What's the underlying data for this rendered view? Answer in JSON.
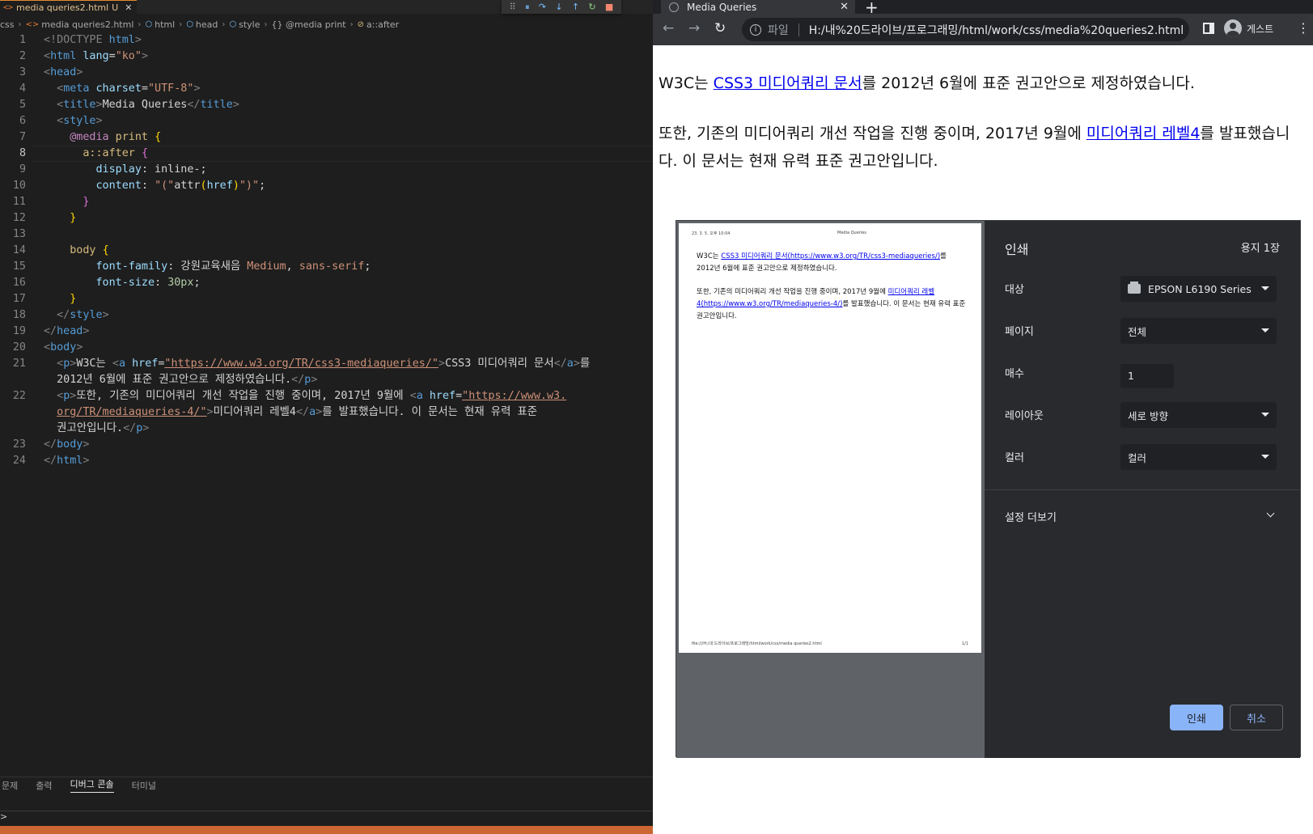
{
  "editor": {
    "tab": {
      "file_icon": "<>",
      "label": "media queries2.html",
      "status": "U",
      "close": "✕"
    },
    "debug_toolbar": [
      "⠿",
      "⏸",
      "↷",
      "↓",
      "↑",
      "↻",
      "■"
    ],
    "breadcrumb": [
      "css",
      "media queries2.html",
      "html",
      "head",
      "style",
      "{} @media print",
      "a::after"
    ],
    "lines": [
      "1",
      "2",
      "3",
      "4",
      "5",
      "6",
      "7",
      "8",
      "9",
      "10",
      "11",
      "12",
      "13",
      "14",
      "15",
      "16",
      "17",
      "18",
      "19",
      "20",
      "21",
      "",
      "22",
      "",
      "",
      "23",
      "24"
    ],
    "code": {
      "l1_doctype": "<!DOCTYPE ",
      "l1_html": "html",
      "l1_end": ">",
      "l2_open": "<",
      "l2_tag": "html",
      "l2_attr": " lang",
      "l2_eq": "=",
      "l2_val": "\"ko\"",
      "l2_end": ">",
      "l3": "head",
      "l4_tag": "meta",
      "l4_attr": " charset",
      "l4_val": "\"UTF-8\"",
      "l5_tag": "title",
      "l5_text": "Media Queries",
      "l6": "style",
      "l7_at": "@media",
      "l7_word": " print ",
      "l8_sel": "a::after",
      "l9_prop": "display",
      "l9_val": " inline-;",
      "l10_prop": "content",
      "l10_val1": "\"(\"",
      "l10_fn": "attr",
      "l10_arg": "href",
      "l10_val2": "\")\"",
      "l14_sel": "body",
      "l15_prop": "font-family",
      "l15_val1": " 강원교육새음 ",
      "l15_val2": "Medium",
      "l15_val3": "sans-serif",
      "l16_prop": "font-size",
      "l16_val": "30px",
      "l17": "}",
      "l18": "style",
      "l19": "head",
      "l20": "body",
      "l21_p": "p",
      "l21_text1": "W3C는 ",
      "l21_a": "a",
      "l21_href": " href",
      "l21_url": "\"https://www.w3.org/TR/css3-mediaqueries/\"",
      "l21_text2": "CSS3 미디어쿼리 문서",
      "l21_text3": "를",
      "l21b_text": "2012년 6월에 표준 권고안으로 제정하였습니다.",
      "l22_text1": "또한, 기존의 미디어쿼리 개선 작업을 진행 중이며, 2017년 9월에 ",
      "l22_url1": "\"https://www.w3.",
      "l22b_url2": "org/TR/mediaqueries-4/\"",
      "l22b_text1": "미디어쿼리 레벨4",
      "l22b_text2": "를 발표했습니다. 이 문서는 현재 유력 표준",
      "l22c_text": "권고안입니다.",
      "l23": "body",
      "l24": "html"
    },
    "panel_tabs": [
      "문제",
      "출력",
      "디버그 콘솔",
      "터미널"
    ],
    "panel_prompt": ">"
  },
  "browser": {
    "tab_title": "Media Queries",
    "tab_close": "✕",
    "new_tab": "+",
    "nav": {
      "back": "←",
      "forward": "→",
      "reload": "↻"
    },
    "omnibox": {
      "scheme": "파일",
      "url": "H:/내%20드라이브/프로그래밍/html/work/css/media%20queries2.html"
    },
    "profile": "게스트",
    "menu": "⋮",
    "page": {
      "p1_before": "W3C는 ",
      "p1_link": "CSS3 미디어쿼리 문서",
      "p1_after": "를 2012년 6월에 표준 권고안으로 제정하였습니다.",
      "p2_before": "또한, 기존의 미디어쿼리 개선 작업을 진행 중이며, 2017년 9월에 ",
      "p2_link": "미디어쿼리 레벨4",
      "p2_after": "를 발표했습니다. 이 문서는 현재 유력 표준 권고안입니다."
    }
  },
  "print_dialog": {
    "preview": {
      "header_date": "23. 3. 5. 오후 10:04",
      "header_title": "Media Queries",
      "p1_before": "W3C는 ",
      "p1_link": "CSS3 미디어쿼리 문서(https://www.w3.org/TR/css3-mediaqueries/)",
      "p1_after": "를 2012년 6월에 표준 권고안으로 제정하였습니다.",
      "p2_before": "또한, 기존의 미디어쿼리 개선 작업을 진행 중이며, 2017년 9월에 ",
      "p2_link": "미디어쿼리 레벨4(https://www.w3.org/TR/mediaqueries-4/)",
      "p2_after": "를 발표했습니다. 이 문서는 현재 유력 표준 권고안입니다.",
      "footer_path": "file:///H:/내 드라이브/프로그래밍/html/work/css/media queries2.html",
      "footer_page": "1/1"
    },
    "title": "인쇄",
    "sheets": "용지 1장",
    "destination_label": "대상",
    "destination_value": "EPSON L6190 Series",
    "pages_label": "페이지",
    "pages_value": "전체",
    "copies_label": "매수",
    "copies_value": "1",
    "layout_label": "레이아웃",
    "layout_value": "세로 방향",
    "color_label": "컬러",
    "color_value": "컬러",
    "more_settings": "설정 더보기",
    "print_button": "인쇄",
    "cancel_button": "취소"
  }
}
